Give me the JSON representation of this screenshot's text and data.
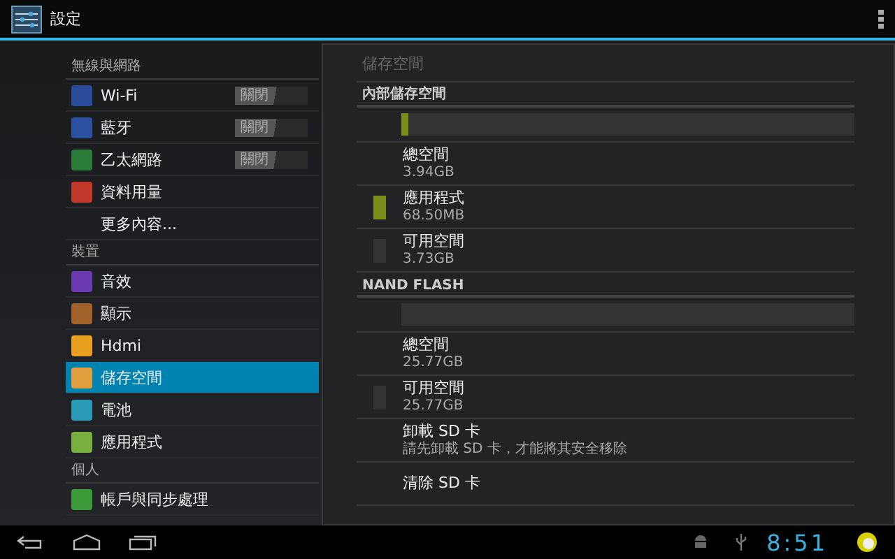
{
  "action_bar": {
    "title": "設定"
  },
  "sidebar": {
    "sections": [
      {
        "header": "無線與網路",
        "items": [
          {
            "label": "Wi-Fi",
            "kind": "toggle",
            "toggle": {
              "label": "關閉",
              "on": false
            },
            "selected": false
          },
          {
            "label": "藍牙",
            "kind": "toggle",
            "toggle": {
              "label": "關閉",
              "on": false
            },
            "selected": false
          },
          {
            "label": "乙太網路",
            "kind": "toggle",
            "toggle": {
              "label": "關閉",
              "on": false
            },
            "selected": false
          },
          {
            "label": "資料用量",
            "kind": "plain",
            "selected": false
          },
          {
            "label": "更多內容...",
            "kind": "text",
            "selected": false
          }
        ]
      },
      {
        "header": "裝置",
        "items": [
          {
            "label": "音效",
            "kind": "plain",
            "selected": false
          },
          {
            "label": "顯示",
            "kind": "plain",
            "selected": false
          },
          {
            "label": "Hdmi",
            "kind": "plain",
            "selected": false
          },
          {
            "label": "儲存空間",
            "kind": "plain",
            "selected": true
          },
          {
            "label": "電池",
            "kind": "plain",
            "selected": false
          },
          {
            "label": "應用程式",
            "kind": "plain",
            "selected": false
          }
        ]
      },
      {
        "header": "個人",
        "items": [
          {
            "label": "帳戶與同步處理",
            "kind": "plain",
            "selected": false
          }
        ]
      }
    ]
  },
  "panel": {
    "title": "儲存空間",
    "sections": [
      {
        "header": "內部儲存空間",
        "rows": [
          {
            "kind": "bar",
            "level": 0.017,
            "color": "#7a8c1a"
          },
          {
            "kind": "item",
            "title": "總空間",
            "value": "3.94GB"
          },
          {
            "kind": "item",
            "title": "應用程式",
            "value": "68.50MB",
            "color": "#7a8c1a"
          },
          {
            "kind": "item",
            "title": "可用空間",
            "value": "3.73GB",
            "color": "#333333"
          }
        ]
      },
      {
        "header": "NAND FLASH",
        "rows": [
          {
            "kind": "bar"
          },
          {
            "kind": "item",
            "title": "總空間",
            "value": "25.77GB"
          },
          {
            "kind": "item",
            "title": "可用空間",
            "value": "25.77GB",
            "color": "#333333"
          },
          {
            "kind": "item",
            "title": "卸載 SD 卡",
            "value": "請先卸載 SD 卡，才能將其安全移除"
          },
          {
            "kind": "item",
            "title": "清除 SD 卡"
          }
        ]
      }
    ]
  },
  "status_bar": {
    "time": "8:51"
  }
}
